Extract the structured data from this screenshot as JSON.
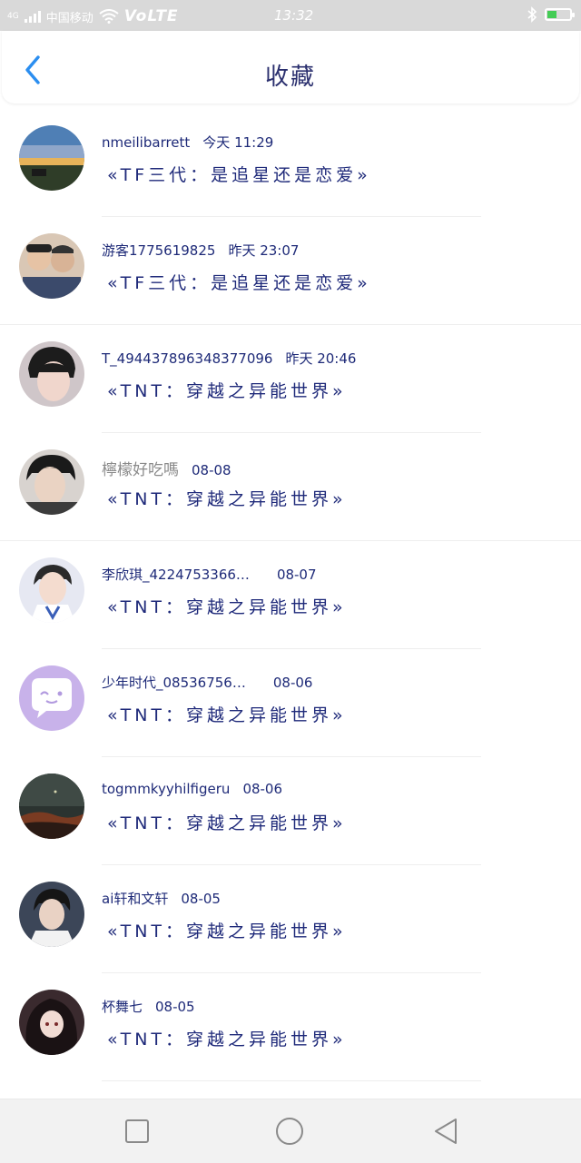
{
  "status_bar": {
    "network": "4G",
    "carrier": "中国移动",
    "volte": "VoLTE",
    "time": "13:32"
  },
  "header": {
    "title": "收藏",
    "back_icon": "chevron-left-icon"
  },
  "items": [
    {
      "name": "nmeilibarrett",
      "time": "今天 11:29",
      "story": "«TF三代：是追星还是恋爱»",
      "avatar": "landscape-sunset"
    },
    {
      "name": "游客1775619825",
      "time": "昨天 23:07",
      "story": "«TF三代：是追星还是恋爱»",
      "avatar": "two-people-selfie"
    },
    {
      "name": "T_494437896348377096",
      "time": "昨天 20:46",
      "story": "«TNT：穿越之异能世界»",
      "avatar": "boy-portrait"
    },
    {
      "name": "檸檬好吃嗎",
      "time": "08-08",
      "story": "«TNT：穿越之异能世界»",
      "avatar": "young-man-portrait"
    },
    {
      "name": "李欣琪_4224753366…",
      "time": "08-07",
      "story": "«TNT：穿越之异能世界»",
      "avatar": "idol-portrait"
    },
    {
      "name": "少年时代_08536756…",
      "time": "08-06",
      "story": "«TNT：穿越之异能世界»",
      "avatar": "default-chat-bubble"
    },
    {
      "name": "togmmkyyhilfigeru",
      "time": "08-06",
      "story": "«TNT：穿越之异能世界»",
      "avatar": "dark-sky"
    },
    {
      "name": "ai轩和文轩",
      "time": "08-05",
      "story": "«TNT：穿越之异能世界»",
      "avatar": "boy-white-shirt"
    },
    {
      "name": "杯舞七",
      "time": "08-05",
      "story": "«TNT：穿越之异能世界»",
      "avatar": "anime-girl"
    }
  ],
  "nav": {
    "recent_icon": "square-icon",
    "home_icon": "circle-icon",
    "back_icon": "triangle-back-icon"
  },
  "colors": {
    "accent": "#2b8ef0",
    "text": "#1e2a78",
    "status_bar": "#d9d9d9",
    "nav_bar": "#f2f2f2"
  }
}
